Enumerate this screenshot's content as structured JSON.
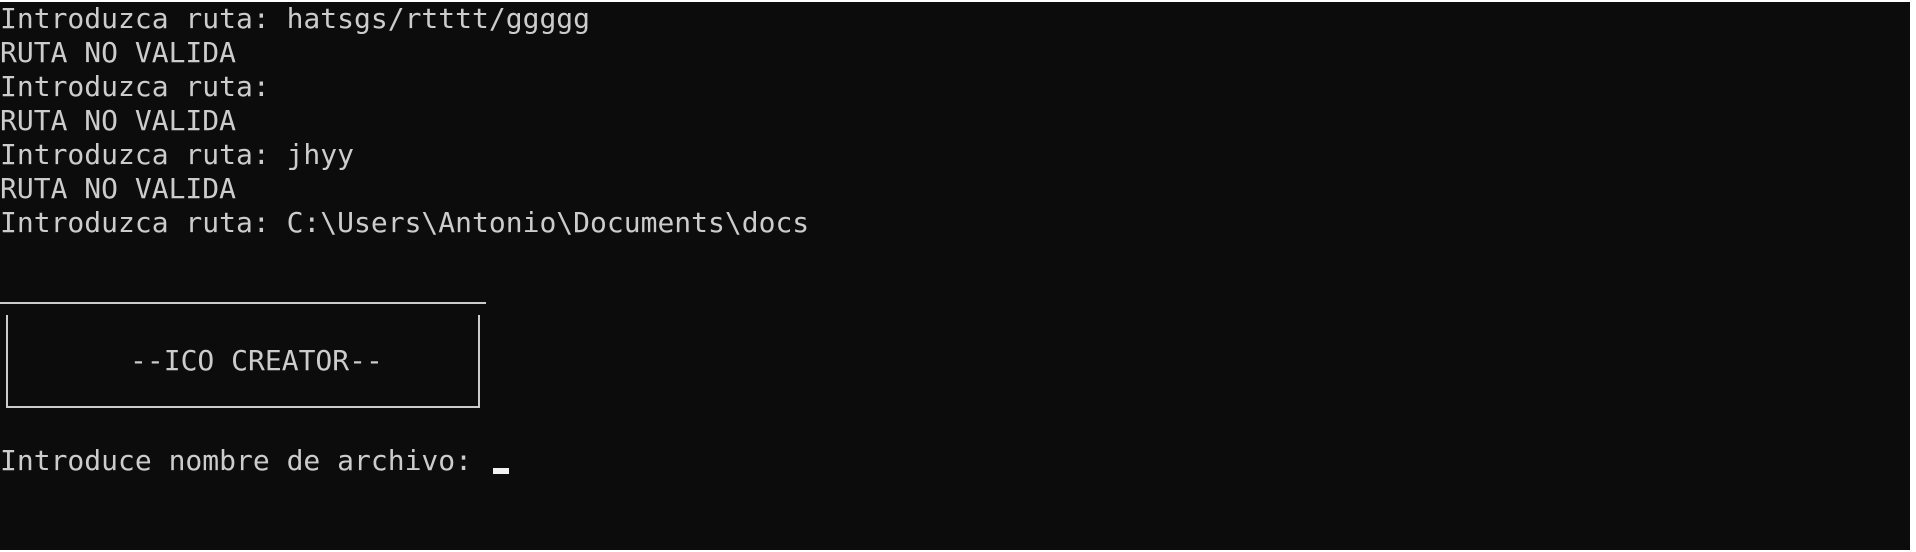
{
  "console": {
    "lines": [
      "Introduzca ruta: hatsgs/rtttt/ggggg",
      "RUTA NO VALIDA",
      "Introduzca ruta:",
      "RUTA NO VALIDA",
      "Introduzca ruta: jhyy",
      "RUTA NO VALIDA",
      "Introduzca ruta: C:\\Users\\Antonio\\Documents\\docs"
    ],
    "banner_title": "--ICO CREATOR--",
    "prompt": "Introduce nombre de archivo:",
    "colors": {
      "background": "#0c0c0c",
      "text": "#cccccc",
      "cursor": "#f2f2f2"
    }
  }
}
